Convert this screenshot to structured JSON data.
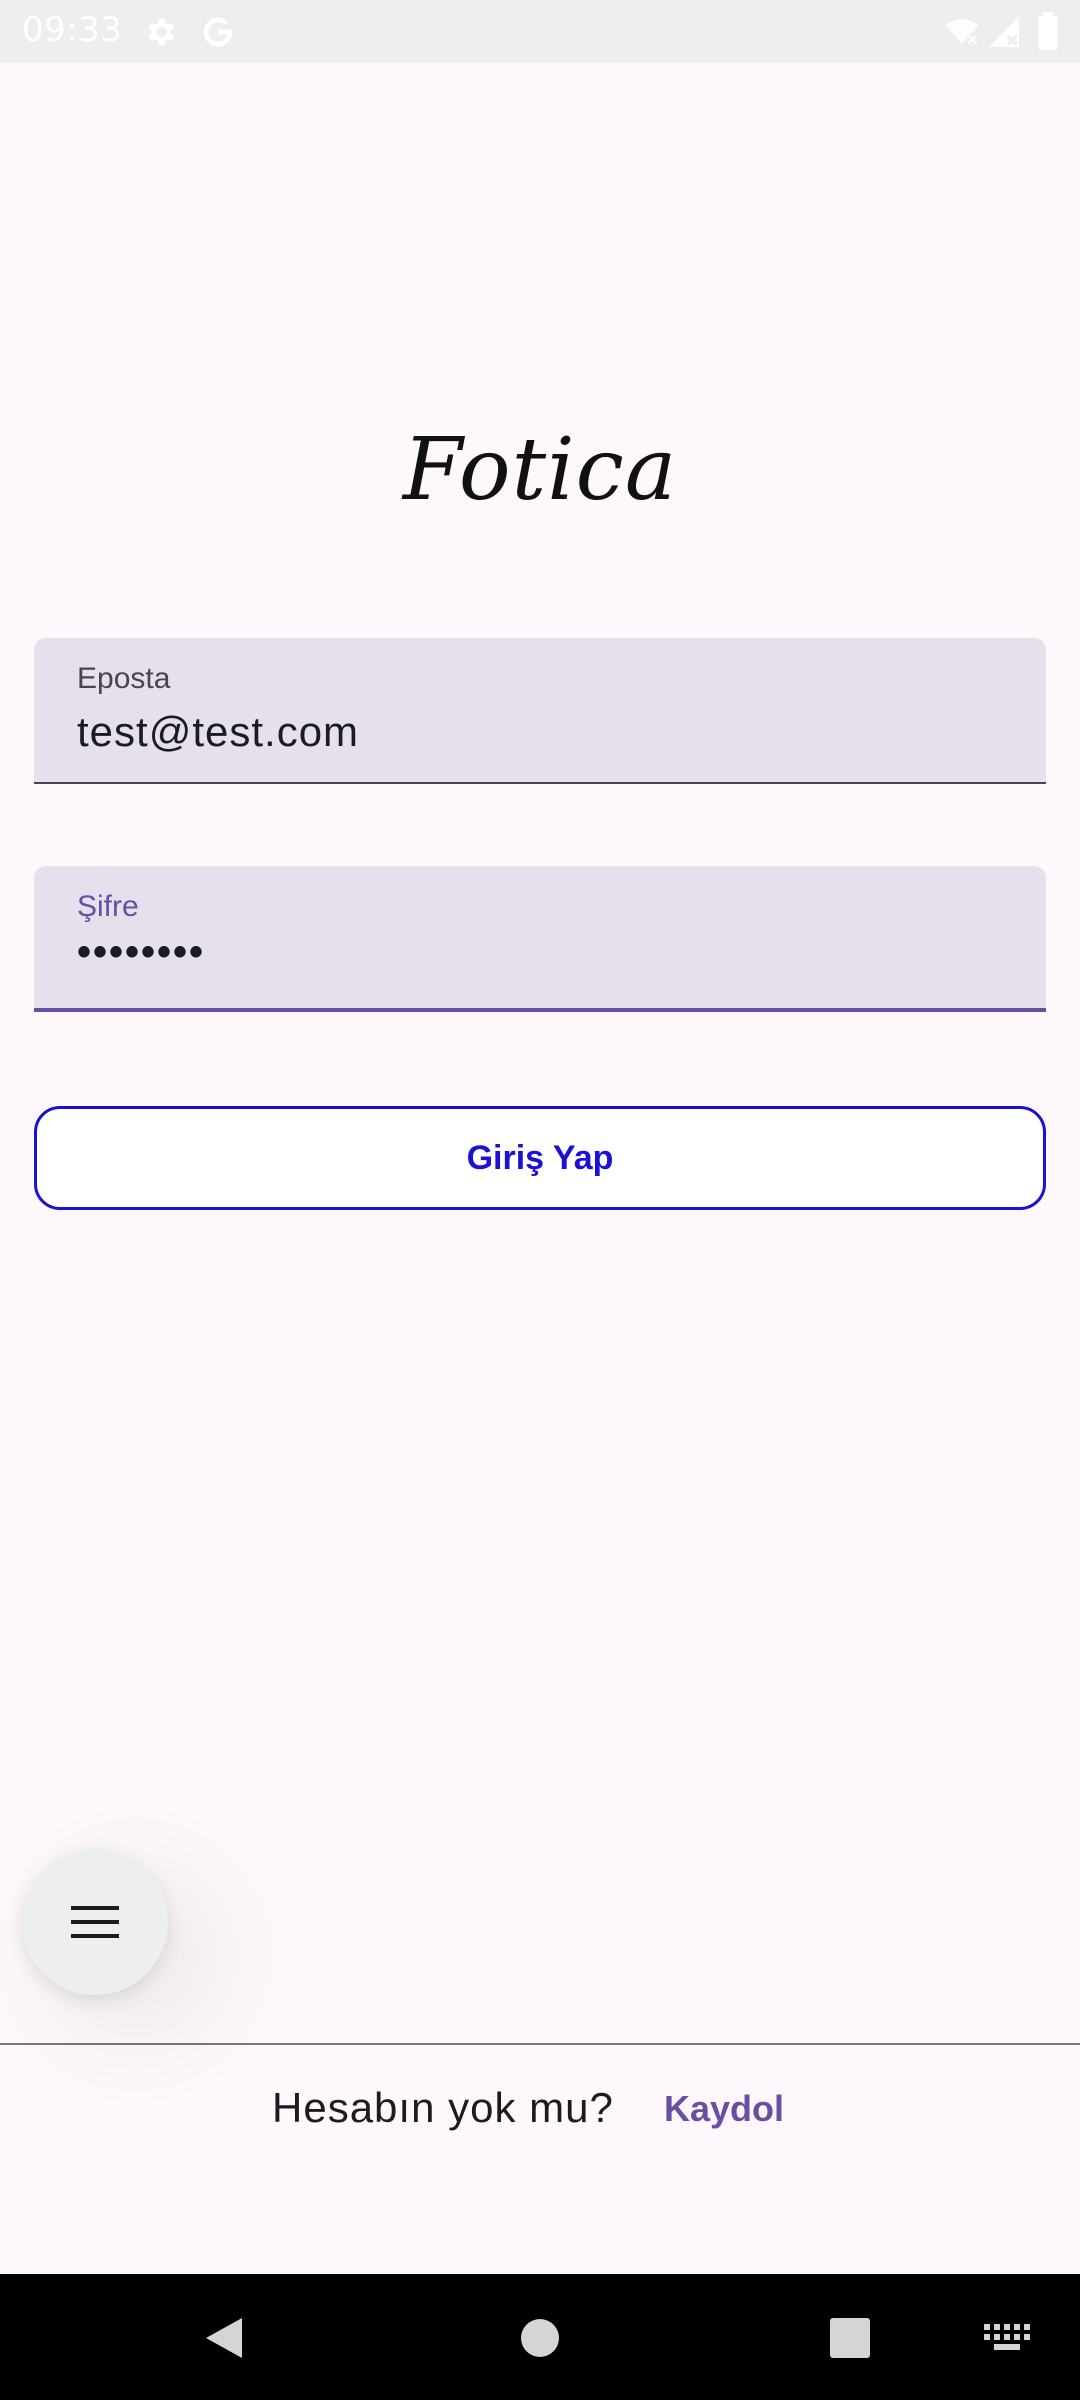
{
  "status_bar": {
    "time": "09:33",
    "icons": [
      "settings-gear-icon",
      "google-g-icon",
      "wifi-off-icon",
      "signal-off-icon",
      "battery-icon"
    ]
  },
  "app": {
    "logo_text": "Fotica"
  },
  "form": {
    "email": {
      "label": "Eposta",
      "value": "test@test.com"
    },
    "password": {
      "label": "Şifre",
      "value": "••••••••"
    },
    "submit_label": "Giriş Yap"
  },
  "fab": {
    "icon": "menu-hamburger-icon"
  },
  "footer": {
    "question": "Hesabın yok mu?",
    "signup_label": "Kaydol"
  },
  "navigation_bar": {
    "buttons": [
      "back-icon",
      "home-icon",
      "recents-icon",
      "keyboard-icon"
    ]
  },
  "colors": {
    "background": "#FEF7FC",
    "field_fill": "#E6DFEC",
    "primary": "#6750A4",
    "button_outline": "#1A10D6"
  }
}
